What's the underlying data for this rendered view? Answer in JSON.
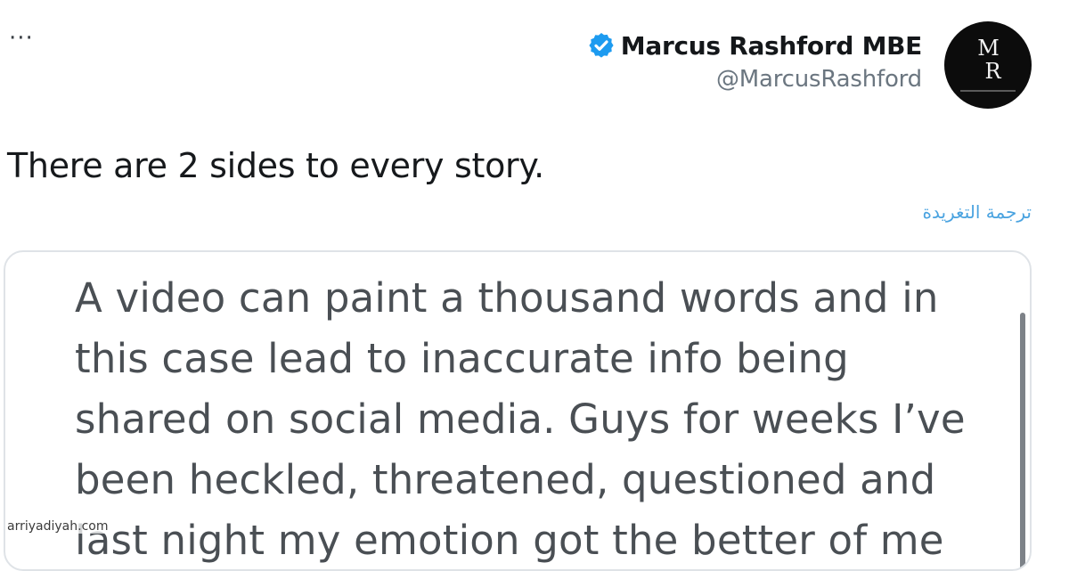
{
  "header": {
    "more_label": "···",
    "display_name": "Marcus Rashford MBE",
    "handle": "@MarcusRashford",
    "verified_icon": "verified-badge-icon",
    "verified_color": "#1d9bf0",
    "avatar_monogram_top": "M",
    "avatar_monogram_bottom": "R"
  },
  "tweet": {
    "text": "There are 2 sides to every story.",
    "translate_label": "ترجمة التغريدة"
  },
  "media": {
    "lines": [
      "A video can paint a thousand words and in",
      "this case lead to inaccurate info being",
      "shared on social media. Guys for weeks I’ve",
      "been heckled, threatened, questioned and",
      "last night my emotion got the better of me"
    ]
  },
  "watermark": "arriyadiyah.com"
}
